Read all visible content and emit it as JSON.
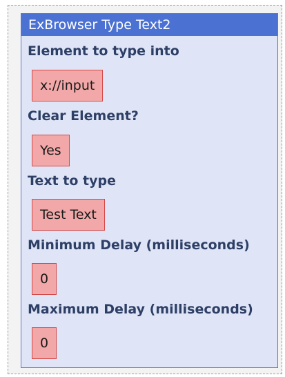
{
  "panel": {
    "title": "ExBrowser Type Text2"
  },
  "fields": [
    {
      "label": "Element to type into",
      "value": "x://input"
    },
    {
      "label": "Clear Element?",
      "value": "Yes"
    },
    {
      "label": "Text to type",
      "value": "Test Text"
    },
    {
      "label": "Minimum Delay (milliseconds)",
      "value": "0"
    },
    {
      "label": "Maximum Delay (milliseconds)",
      "value": "0"
    }
  ],
  "colors": {
    "title_bar": "#4b72d3",
    "panel_background": "#dfe5f7",
    "value_background": "#f2a8a8",
    "value_border": "#d44848",
    "label_text": "#2e3f66"
  }
}
